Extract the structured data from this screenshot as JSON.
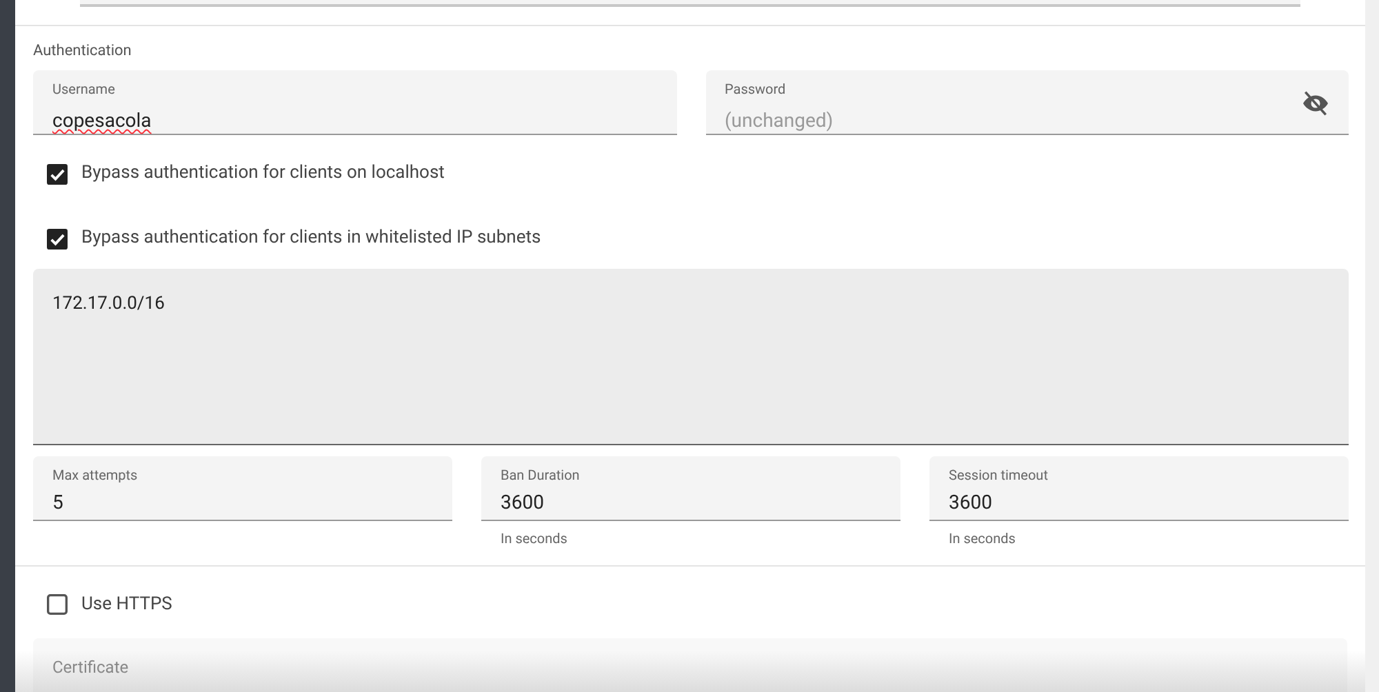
{
  "section_title": "Authentication",
  "username": {
    "label": "Username",
    "value": "copesacola"
  },
  "password": {
    "label": "Password",
    "placeholder": "(unchanged)",
    "visible": false
  },
  "bypass_options": [
    {
      "label": "Bypass authentication for clients on localhost",
      "checked": true
    },
    {
      "label": "Bypass authentication for clients in whitelisted IP subnets",
      "checked": true
    }
  ],
  "whitelist": {
    "value": "172.17.0.0/16"
  },
  "limits": [
    {
      "label": "Max attempts",
      "value": "5"
    },
    {
      "label": "Ban Duration",
      "value": "3600",
      "helper": "In seconds"
    },
    {
      "label": "Session timeout",
      "value": "3600",
      "helper": "In seconds"
    }
  ],
  "https": {
    "label": "Use HTTPS",
    "checked": false
  },
  "certificate": {
    "label": "Certificate"
  }
}
